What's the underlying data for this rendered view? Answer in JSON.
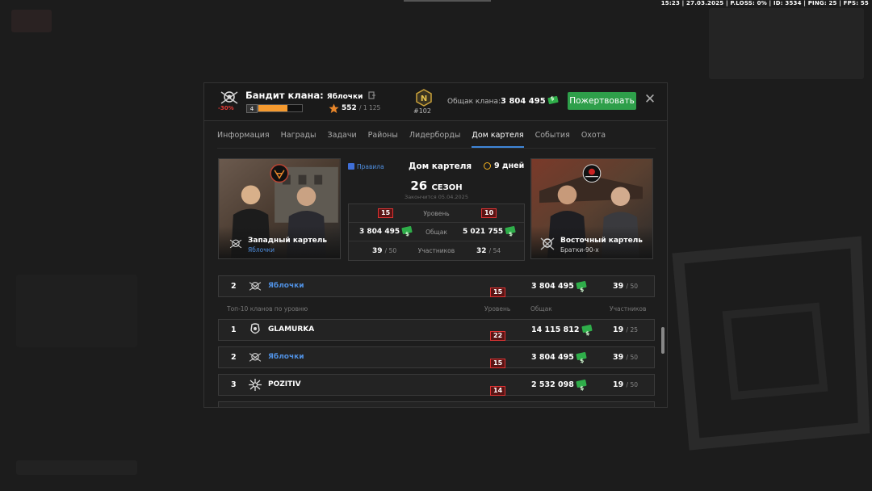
{
  "status_bar": "15:23 | 27.03.2025 | P.LOSS: 0% | ID: 3534 | PING: 25 | FPS: 55",
  "header": {
    "rank_title": "Бандит клана:",
    "clan_name": "Яблочки",
    "discount": "-30%",
    "level": "4",
    "xp_progress": 0.66,
    "xp_value": "552",
    "xp_max": "/ 1 125",
    "rank_num": "#102",
    "clan_total_label": "Общак клана:",
    "clan_total_value": "3 804 495",
    "donate_label": "Пожертвовать",
    "close_label": "✕"
  },
  "tabs": [
    {
      "label": "Информация",
      "active": false
    },
    {
      "label": "Награды",
      "active": false
    },
    {
      "label": "Задачи",
      "active": false
    },
    {
      "label": "Районы",
      "active": false
    },
    {
      "label": "Лидерборды",
      "active": false
    },
    {
      "label": "Дом картеля",
      "active": true
    },
    {
      "label": "События",
      "active": false
    },
    {
      "label": "Охота",
      "active": false
    }
  ],
  "cartel": {
    "rules_label": "Правила",
    "title": "Дом картеля",
    "days_label": "9 дней",
    "season_num": "26",
    "season_word": "СЕЗОН",
    "ended_label": "Закончится 05.04.2025",
    "level_label": "Уровень",
    "total_label": "Общак",
    "members_label": "Участников",
    "west": {
      "name": "Западный картель",
      "clan": "Яблочки",
      "level": "15",
      "total": "3 804 495",
      "members": "39",
      "members_max": "/ 50"
    },
    "east": {
      "name": "Восточный картель",
      "clan": "Братки-90-х",
      "level": "10",
      "total": "5 021 755",
      "members": "32",
      "members_max": "/ 54"
    }
  },
  "my_row": {
    "pos": "2",
    "name": "Яблочки",
    "level": "15",
    "total": "3 804 495",
    "members": "39",
    "members_max": "/ 50"
  },
  "list_header": {
    "title": "Топ-10 кланов по уровню",
    "level": "Уровень",
    "total": "Общак",
    "members": "Участников"
  },
  "rows": [
    {
      "pos": "1",
      "name": "GLAMURKA",
      "level": "22",
      "total": "14 115 812",
      "members": "19",
      "members_max": "/ 25",
      "mine": false
    },
    {
      "pos": "2",
      "name": "Яблочки",
      "level": "15",
      "total": "3 804 495",
      "members": "39",
      "members_max": "/ 50",
      "mine": true
    },
    {
      "pos": "3",
      "name": "POZITIV",
      "level": "14",
      "total": "2 532 098",
      "members": "19",
      "members_max": "/ 50",
      "mine": false
    }
  ],
  "colors": {
    "accent_blue": "#3f86d8",
    "donate_green": "#2e9f4a",
    "level_red": "#d33",
    "xp_orange": "#f59a2f"
  }
}
